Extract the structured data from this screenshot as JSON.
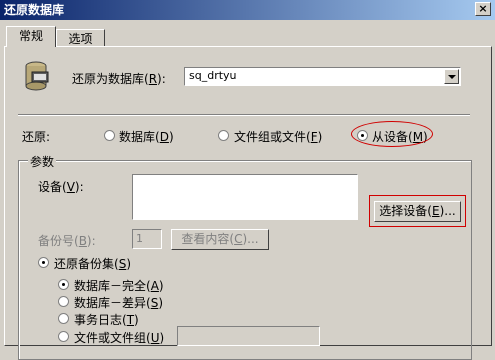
{
  "window": {
    "title": "还原数据库",
    "close_glyph": "×"
  },
  "tabs": [
    {
      "label": "常规"
    },
    {
      "label": "选项"
    }
  ],
  "restore_as": {
    "label": "还原为数据库(",
    "accel": "R",
    "label_tail": "):",
    "value": "sq_drtyu"
  },
  "restore_from": {
    "label": "还原:",
    "options": [
      {
        "label": "数据库(",
        "accel": "D",
        "tail": ")",
        "selected": false
      },
      {
        "label": "文件组或文件(",
        "accel": "F",
        "tail": ")",
        "selected": false
      },
      {
        "label": "从设备(",
        "accel": "M",
        "tail": ")",
        "selected": true
      }
    ]
  },
  "params": {
    "legend": "参数",
    "device_label": "设备(",
    "device_accel": "V",
    "device_tail": "):",
    "select_device_button": "选择设备(",
    "select_device_accel": "E",
    "select_device_tail": ")...",
    "backup_no_label": "备份号(",
    "backup_no_accel": "B",
    "backup_no_tail": "):",
    "backup_no_value": "1",
    "view_contents_button": "查看内容(",
    "view_contents_accel": "C",
    "view_contents_tail": ")...",
    "restore_backup_set": {
      "label": "还原备份集(",
      "accel": "S",
      "tail": ")",
      "checked": true
    },
    "set_types": [
      {
        "label": "数据库－完全(",
        "accel": "A",
        "tail": ")",
        "selected": true
      },
      {
        "label": "数据库－差异(",
        "accel": "S",
        "tail": ")",
        "selected": false
      },
      {
        "label": "事务日志(",
        "accel": "T",
        "tail": ")",
        "selected": false
      },
      {
        "label": "文件或文件组(",
        "accel": "U",
        "tail": ")",
        "selected": false
      }
    ]
  },
  "colors": {
    "highlight": "#d00000",
    "title_start": "#0a246a",
    "title_end": "#a6caf0"
  },
  "icons": {
    "database": "database-icon"
  }
}
